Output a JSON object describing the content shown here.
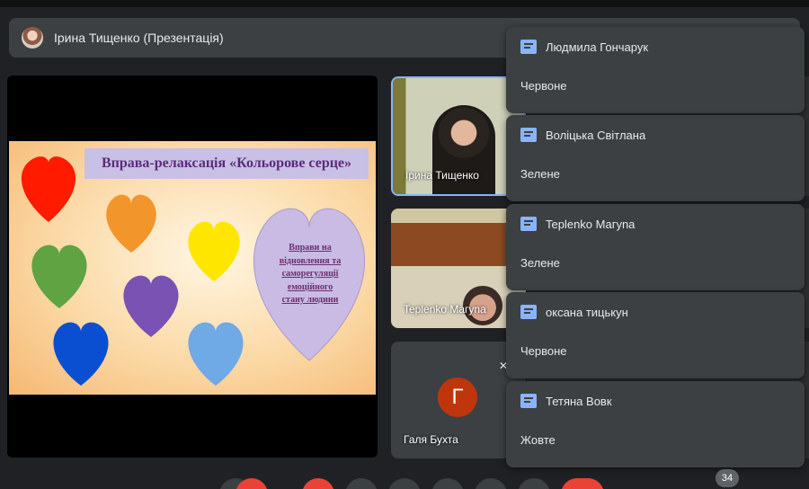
{
  "presenter_bar": {
    "name": "Ірина Тищенко (Презентація)"
  },
  "slide": {
    "title": "Вправа-релаксація «Кольорове серце»",
    "big_heart_lines": [
      "Вправи на",
      "відновлення та",
      "саморегуляції",
      "емоційного",
      "стану людини"
    ],
    "heart_colors": [
      "#ff1a00",
      "#f2952b",
      "#ffe600",
      "#5fa343",
      "#7a52b3",
      "#6fa9e6",
      "#0a4fd1",
      "#c9bbe3"
    ]
  },
  "tiles": [
    {
      "name": "Ірина Тищенко"
    },
    {
      "name": "Teplenko Maгуna"
    },
    {
      "name": "Галя Бухта",
      "initial": "Г"
    }
  ],
  "toasts": [
    {
      "name": "Людмила Гончарук",
      "message": "Червоне"
    },
    {
      "name": "Воліцька Світлана",
      "message": "Зелене"
    },
    {
      "name": "Teplenko Maгуna",
      "message": "Зелене"
    },
    {
      "name": "оксана тицькун",
      "message": "Червоне"
    },
    {
      "name": "Тетяна Вовк",
      "message": "Жовте"
    }
  ],
  "controls": {
    "people_count": "34"
  },
  "colors": {
    "accent": "#8ab4f8",
    "hangup": "#ea4335",
    "surface": "#3c4043",
    "background": "#202124"
  }
}
